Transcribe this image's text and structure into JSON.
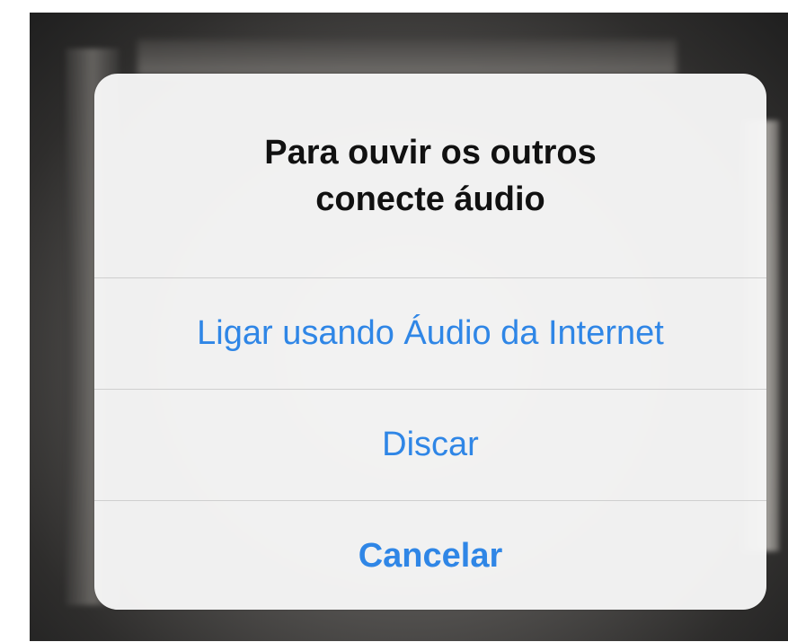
{
  "alert": {
    "title": "Para ouvir os outros\nconecte áudio",
    "actions": [
      {
        "label": "Ligar usando Áudio da Internet"
      },
      {
        "label": "Discar"
      },
      {
        "label": "Cancelar"
      }
    ]
  },
  "colors": {
    "action_text": "#2f86e6",
    "title_text": "#111111",
    "alert_background": "#f6f6f6"
  }
}
